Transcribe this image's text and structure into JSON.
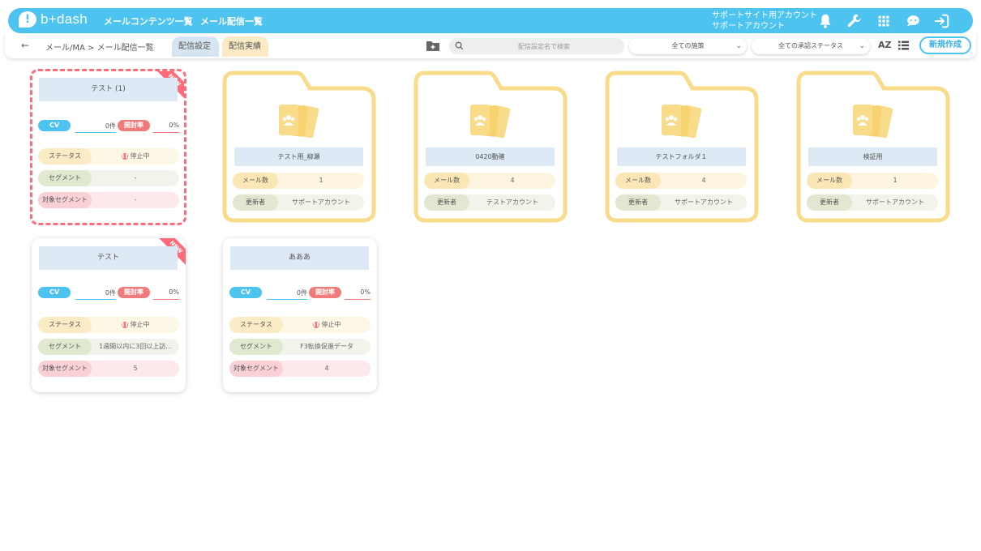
{
  "header": {
    "logo": "b+dash",
    "logo_mark": "!",
    "nav": [
      "メールコンテンツ一覧",
      "メール配信一覧"
    ],
    "account_line1": "サポートサイト用アカウント",
    "account_line2": "サポートアカウント",
    "icons": [
      "bell-icon",
      "wrench-icon",
      "grid-icon",
      "chat-icon",
      "logout-icon"
    ]
  },
  "toolbar": {
    "back": "←",
    "breadcrumb": "メール/MA > メール配信一覧",
    "tabs": [
      "配信設定",
      "配信実績"
    ],
    "search_placeholder": "配信設定名で検索",
    "filter_campaign": "全ての施策",
    "filter_status": "全ての承認ステータス",
    "sort_label": "AZ",
    "new_button": "新規作成"
  },
  "labels": {
    "cv": "CV",
    "open_rate": "開封率",
    "status": "ステータス",
    "segment": "セグメント",
    "target_segment": "対象セグメント",
    "mail_count": "メール数",
    "updated_by": "更新者",
    "new_badge": "NEW"
  },
  "cards": [
    {
      "title": "テスト (1)",
      "cv": "0件",
      "open_rate": "0%",
      "status": "停止中",
      "segment": "-",
      "target": "-",
      "is_new": true
    },
    {
      "title": "テスト",
      "cv": "0件",
      "open_rate": "0%",
      "status": "停止中",
      "segment": "1週間以内に3回以上訪...",
      "target": "5",
      "is_new": true
    },
    {
      "title": "あああ",
      "cv": "0件",
      "open_rate": "0%",
      "status": "停止中",
      "segment": "F3転換促進データ",
      "target": "4",
      "is_new": false
    }
  ],
  "folders": [
    {
      "title": "テスト用_柳瀬",
      "mail_count": "1",
      "updated_by": "サポートアカウント"
    },
    {
      "title": "0420動確",
      "mail_count": "4",
      "updated_by": "テストアカウント"
    },
    {
      "title": "テストフォルダ１",
      "mail_count": "4",
      "updated_by": "サポートアカウント"
    },
    {
      "title": "検証用",
      "mail_count": "1",
      "updated_by": "サポートアカウント"
    }
  ],
  "colors": {
    "brand": "#4dc3f0",
    "folder": "#f8dc8a",
    "new_badge": "#ff6b7a",
    "open_rate": "#f07b7b"
  }
}
